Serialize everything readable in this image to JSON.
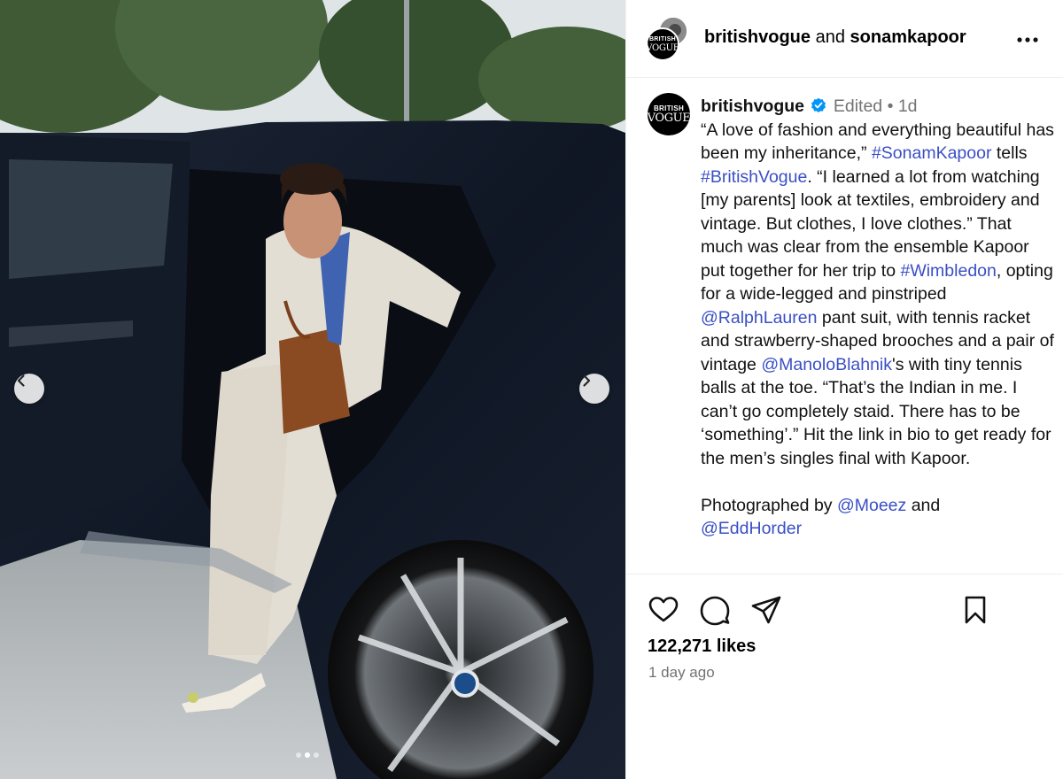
{
  "header": {
    "primary_user": "britishvogue",
    "joiner": "and",
    "collab_user": "sonamkapoor",
    "more_icon": "more-horizontal-icon",
    "avatar_brand_top": "BRITISH",
    "avatar_brand_bottom": "VOGUE"
  },
  "carousel": {
    "prev_icon": "chevron-left-icon",
    "next_icon": "chevron-right-icon",
    "slide_count": 3,
    "active_index": 1
  },
  "caption": {
    "username": "britishvogue",
    "verified_icon": "verified-badge-icon",
    "edited": "Edited",
    "separator": "•",
    "time": "1d",
    "seg1": "“A love of fashion and everything beautiful has been my inheritance,” ",
    "tag1": "#SonamKapoor",
    "seg2": " tells ",
    "tag2": "#BritishVogue",
    "seg3": ". “I learned a lot from watching [my parents] look at textiles, embroidery and vintage. But clothes, I love clothes.” That much was clear from the ensemble Kapoor put together for her trip to ",
    "tag3": "#Wimbledon",
    "seg4": ", opting for a wide-legged and pinstriped ",
    "tag4": "@RalphLauren",
    "seg5": " pant suit, with tennis racket and strawberry-shaped brooches and a pair of vintage ",
    "tag5": "@ManoloBlahnik",
    "seg6": "'s with tiny tennis balls at the toe. “That’s the Indian in me. I can’t go completely staid. There has to be ‘something’.” Hit the link in bio to get ready for the men’s singles final with Kapoor.",
    "credit_prefix": "Photographed by ",
    "credit_tag1": "@Moeez",
    "credit_joiner": " and",
    "credit_tag2": "@EddHorder"
  },
  "actions": {
    "like_icon": "heart-icon",
    "comment_icon": "comment-icon",
    "share_icon": "send-icon",
    "save_icon": "bookmark-icon",
    "likes": "122,271 likes",
    "posted": "1 day ago"
  }
}
